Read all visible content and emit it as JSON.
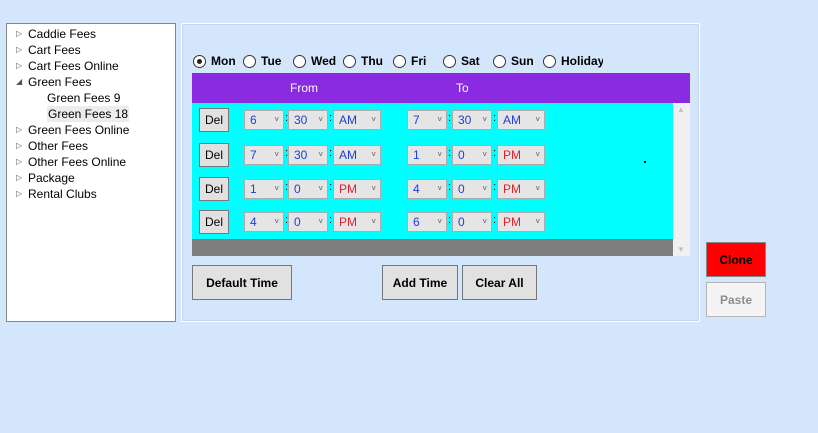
{
  "tree": {
    "items": [
      {
        "label": "Caddie Fees",
        "expander": "collapsed"
      },
      {
        "label": "Cart Fees",
        "expander": "collapsed"
      },
      {
        "label": "Cart Fees Online",
        "expander": "collapsed"
      },
      {
        "label": "Green Fees",
        "expander": "expanded"
      },
      {
        "label": "Green Fees 9",
        "expander": "none"
      },
      {
        "label": "Green Fees 18",
        "expander": "none",
        "selected": true
      },
      {
        "label": "Green Fees Online",
        "expander": "collapsed"
      },
      {
        "label": "Other Fees",
        "expander": "collapsed"
      },
      {
        "label": "Other Fees Online",
        "expander": "collapsed"
      },
      {
        "label": "Package",
        "expander": "collapsed"
      },
      {
        "label": "Rental Clubs",
        "expander": "collapsed"
      }
    ]
  },
  "days": [
    {
      "label": "Mon",
      "checked": true
    },
    {
      "label": "Tue",
      "checked": false
    },
    {
      "label": "Wed",
      "checked": false
    },
    {
      "label": "Thu",
      "checked": false
    },
    {
      "label": "Fri",
      "checked": false
    },
    {
      "label": "Sat",
      "checked": false
    },
    {
      "label": "Sun",
      "checked": false
    },
    {
      "label": "Holiday",
      "checked": false
    }
  ],
  "grid": {
    "from_label": "From",
    "to_label": "To",
    "header_color": "#8a2be2",
    "rows_color": "#00ffff",
    "del_label": "Del",
    "rows": [
      {
        "from": {
          "h": "6",
          "m": "30",
          "ap": "AM"
        },
        "to": {
          "h": "7",
          "m": "30",
          "ap": "AM"
        }
      },
      {
        "from": {
          "h": "7",
          "m": "30",
          "ap": "AM"
        },
        "to": {
          "h": "1",
          "m": "0",
          "ap": "PM"
        }
      },
      {
        "from": {
          "h": "1",
          "m": "0",
          "ap": "PM"
        },
        "to": {
          "h": "4",
          "m": "0",
          "ap": "PM"
        }
      },
      {
        "from": {
          "h": "4",
          "m": "0",
          "ap": "PM"
        },
        "to": {
          "h": "6",
          "m": "0",
          "ap": "PM"
        }
      }
    ]
  },
  "buttons": {
    "default_time": "Default Time",
    "add_time": "Add Time",
    "clear_all": "Clear All",
    "clone": "Clone",
    "paste": "Paste",
    "clone_color": "#ff0000"
  }
}
